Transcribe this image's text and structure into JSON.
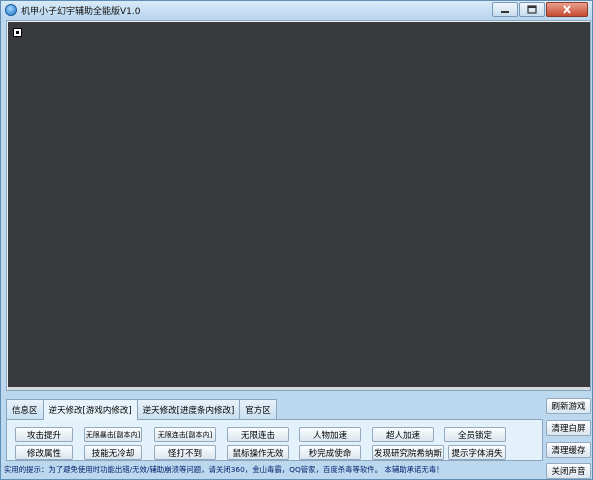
{
  "window": {
    "title": "机甲小子幻宇辅助全能版V1.0"
  },
  "tabs": [
    {
      "label": "信息区"
    },
    {
      "label": "逆天修改[游戏内修改]"
    },
    {
      "label": "逆天修改[进度条内修改]"
    },
    {
      "label": "官方区"
    }
  ],
  "active_tab": 1,
  "panel": {
    "row1": [
      "攻击提升",
      "无限暴击[副本内]",
      "无限连击[副本内]",
      "无限连击",
      "人物加速",
      "超人加速",
      "全员锁定"
    ],
    "row2": [
      "修改属性",
      "技能无冷却",
      "怪打不到",
      "鼠标操作无效",
      "秒完成使命",
      "发现研究院希纳斯",
      "提示字体消失"
    ]
  },
  "side_buttons": [
    "刷新游戏",
    "清理白屏",
    "清理缓存",
    "关闭声音"
  ],
  "status_text": "实用的提示：为了避免使用时功能出错/无效/辅助崩溃等问题，请关闭360，金山毒霸，QQ管家，百度杀毒等软件。  本辅助承诺无毒！",
  "icons": {
    "app": "app-icon",
    "minimize": "minimize-icon",
    "maximize": "maximize-icon",
    "close": "close-icon"
  }
}
